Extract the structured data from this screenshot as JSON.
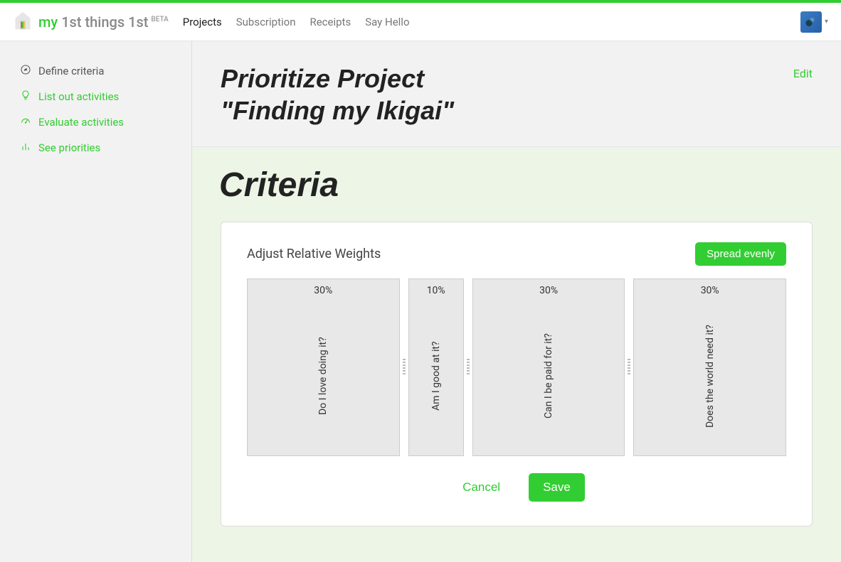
{
  "brand": {
    "prefix": "my",
    "rest": " 1st things 1st",
    "beta": "BETA"
  },
  "nav": {
    "projects": "Projects",
    "subscription": "Subscription",
    "receipts": "Receipts",
    "say_hello": "Say Hello"
  },
  "sidebar": {
    "items": [
      {
        "icon": "compass-icon",
        "label": "Define criteria",
        "current": true
      },
      {
        "icon": "bulb-icon",
        "label": "List out activities",
        "current": false
      },
      {
        "icon": "gauge-icon",
        "label": "Evaluate activities",
        "current": false
      },
      {
        "icon": "bars-icon",
        "label": "See priorities",
        "current": false
      }
    ]
  },
  "header": {
    "title_line1": "Prioritize Project",
    "title_line2": "\"Finding my Ikigai\"",
    "edit": "Edit"
  },
  "section": {
    "heading": "Criteria",
    "card_title": "Adjust Relative Weights",
    "spread_btn": "Spread evenly",
    "cancel": "Cancel",
    "save": "Save"
  },
  "criteria": [
    {
      "label": "Do I love doing it?",
      "weight": 30
    },
    {
      "label": "Am I good at it?",
      "weight": 10
    },
    {
      "label": "Can I be paid for it?",
      "weight": 30
    },
    {
      "label": "Does the world need it?",
      "weight": 30
    }
  ]
}
